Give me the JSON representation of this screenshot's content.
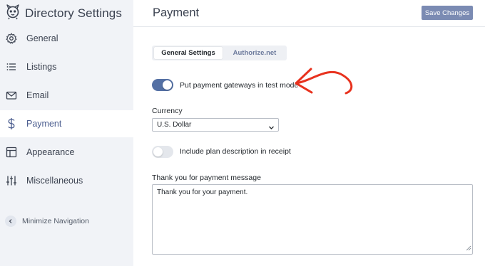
{
  "sidebar": {
    "title": "Directory Settings",
    "logo_icon": "mascot-logo-icon",
    "items": [
      {
        "label": "General",
        "icon": "gear-icon"
      },
      {
        "label": "Listings",
        "icon": "list-icon"
      },
      {
        "label": "Email",
        "icon": "envelope-icon"
      },
      {
        "label": "Payment",
        "icon": "dollar-icon",
        "active": true
      },
      {
        "label": "Appearance",
        "icon": "layout-icon"
      },
      {
        "label": "Miscellaneous",
        "icon": "sliders-icon"
      }
    ],
    "minimize_label": "Minimize Navigation"
  },
  "header": {
    "title": "Payment",
    "save_label": "Save Changes"
  },
  "tabs": [
    {
      "label": "General Settings",
      "active": true
    },
    {
      "label": "Authorize.net",
      "active": false
    }
  ],
  "settings": {
    "test_mode": {
      "label": "Put payment gateways in test mode",
      "enabled": true
    },
    "currency": {
      "label": "Currency",
      "value": "U.S. Dollar"
    },
    "plan_description": {
      "label": "Include plan description in receipt",
      "enabled": false
    },
    "thank_you": {
      "label": "Thank you for payment message",
      "value": "Thank you for your payment."
    }
  },
  "colors": {
    "accent": "#5470a4",
    "save_button": "#7b8bb3",
    "annotation_arrow": "#e8321e",
    "sidebar_bg": "#f1f3f7"
  }
}
